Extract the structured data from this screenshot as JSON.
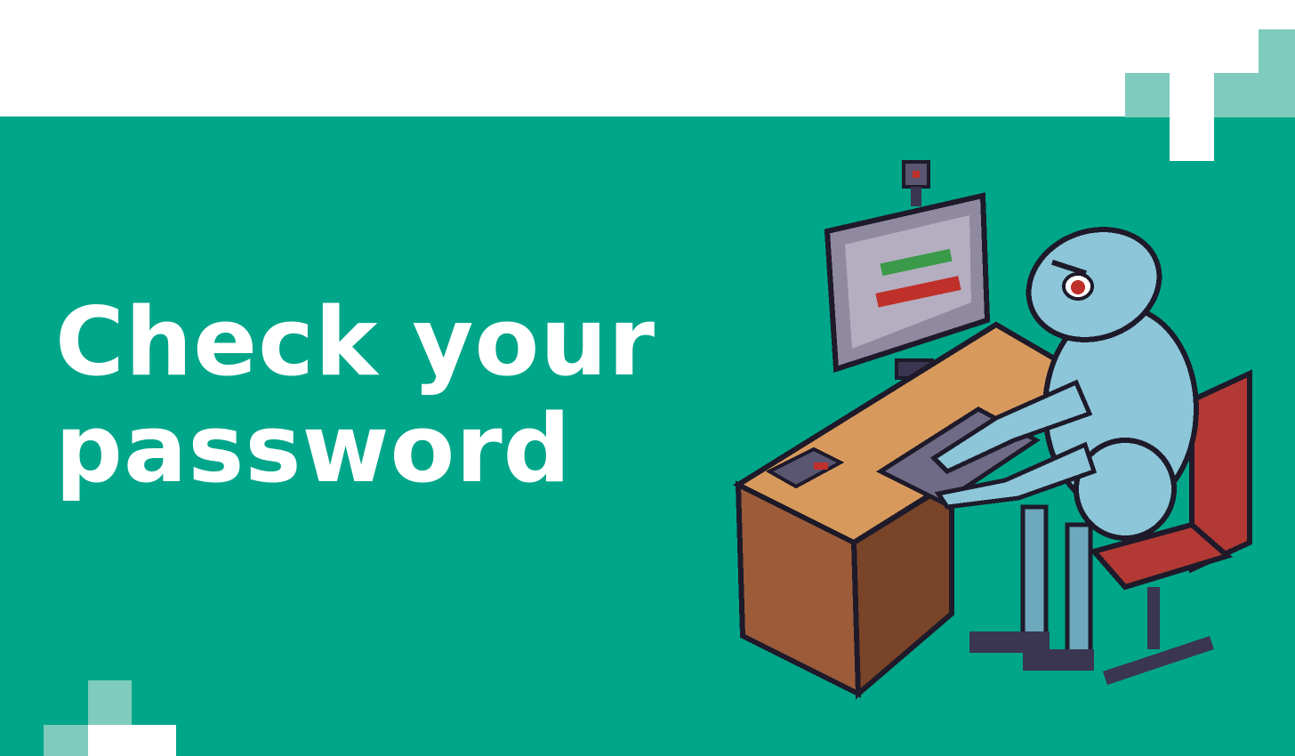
{
  "headline": {
    "line1": "Check your",
    "line2": "password"
  },
  "colors": {
    "banner": "#00a68a",
    "pixel_light": "#7fcbbd",
    "white": "#ffffff",
    "desk_top": "#d89a5c",
    "desk_front": "#9c5c3a",
    "robot": "#8cc6d8",
    "chair": "#b33a34",
    "monitor": "#8f8aa0"
  },
  "illustration": {
    "icon": "robot-at-computer-illustration"
  }
}
